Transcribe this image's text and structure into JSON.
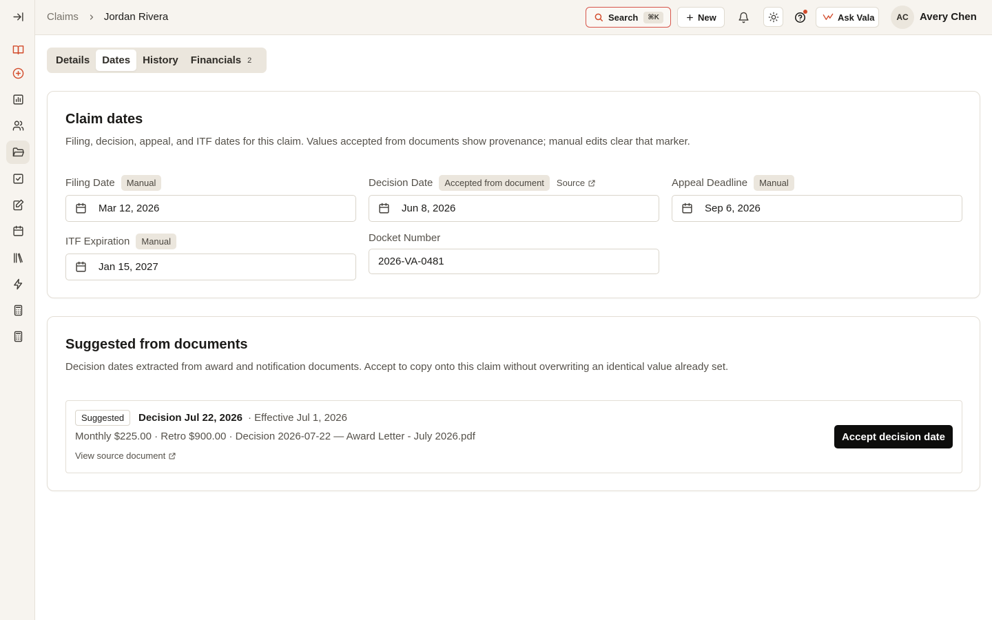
{
  "colors": {
    "brand_accent": "#d24a2a",
    "sidebar_bg": "#f7f4ef",
    "badge_bg": "#ebe6dd",
    "primary_button": "#0d0d0c"
  },
  "sidebar": {
    "items": [
      {
        "name": "collapse-sidebar",
        "icon": "arrow-right-to-line-icon"
      },
      {
        "name": "book",
        "icon": "book-open-icon"
      },
      {
        "name": "new-case",
        "icon": "plus-circle-icon"
      },
      {
        "name": "reports",
        "icon": "bar-chart-icon"
      },
      {
        "name": "people",
        "icon": "users-icon"
      },
      {
        "name": "claims",
        "icon": "folder-open-icon",
        "active": true
      },
      {
        "name": "tasks",
        "icon": "checkbox-icon"
      },
      {
        "name": "notes",
        "icon": "notepad-pen-icon"
      },
      {
        "name": "calendar",
        "icon": "calendar-icon"
      },
      {
        "name": "library",
        "icon": "library-icon"
      },
      {
        "name": "automations",
        "icon": "zap-icon"
      },
      {
        "name": "calculator",
        "icon": "calculator-icon"
      },
      {
        "name": "calculator-2",
        "icon": "calculator-icon"
      }
    ]
  },
  "header": {
    "breadcrumb": {
      "parent": "Claims",
      "current": "Jordan Rivera"
    },
    "search_label": "Search",
    "search_shortcut": "⌘K",
    "new_label": "New",
    "ask_label": "Ask Vala",
    "user": {
      "initials": "AC",
      "name": "Avery Chen"
    }
  },
  "tabs": [
    {
      "label": "Details",
      "active": false
    },
    {
      "label": "Dates",
      "active": true
    },
    {
      "label": "History",
      "active": false
    },
    {
      "label": "Financials",
      "active": false,
      "count": "2"
    }
  ],
  "claim_dates": {
    "title": "Claim dates",
    "description": "Filing, decision, appeal, and ITF dates for this claim. Values accepted from documents show provenance; manual edits clear that marker.",
    "fields": {
      "filing_date": {
        "label": "Filing Date",
        "badge": "Manual",
        "value": "Mar 12, 2026"
      },
      "decision_date": {
        "label": "Decision Date",
        "badge": "Accepted from document",
        "source_label": "Source",
        "value": "Jun 8, 2026"
      },
      "appeal_deadline": {
        "label": "Appeal Deadline",
        "badge": "Manual",
        "value": "Sep 6, 2026"
      },
      "itf_expiration": {
        "label": "ITF Expiration",
        "badge": "Manual",
        "value": "Jan 15, 2027"
      },
      "docket_number": {
        "label": "Docket Number",
        "value": "2026-VA-0481"
      }
    }
  },
  "suggested": {
    "title": "Suggested from documents",
    "description": "Decision dates extracted from award and notification documents. Accept to copy onto this claim without overwriting an identical value already set.",
    "item": {
      "badge": "Suggested",
      "title": "Decision Jul 22, 2026",
      "effective": "· Effective Jul 1, 2026",
      "details": "Monthly $225.00 · Retro $900.00 · Decision 2026-07-22 — Award Letter - July 2026.pdf",
      "link_label": "View source document",
      "accept_label": "Accept decision date"
    }
  }
}
